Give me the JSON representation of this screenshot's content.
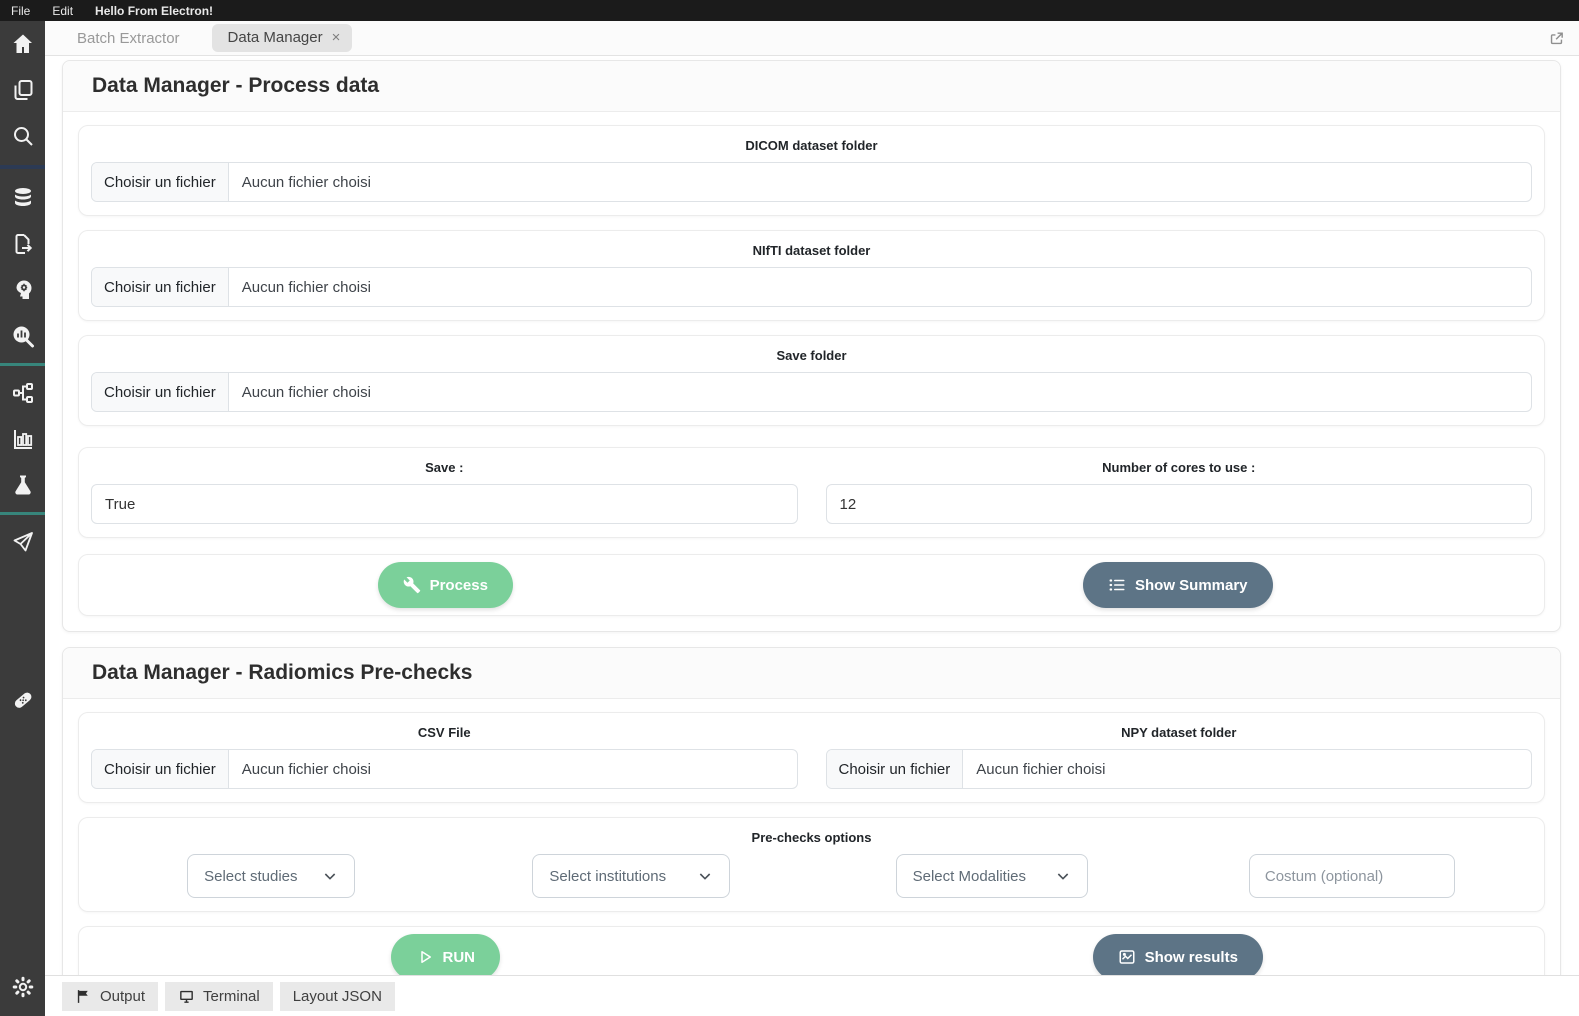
{
  "menu": {
    "file": "File",
    "edit": "Edit",
    "app_title": "Hello From Electron!"
  },
  "tabs": {
    "inactive_label": "Batch Extractor",
    "active_label": "Data Manager",
    "close_glyph": "×"
  },
  "strings": {
    "file_button": "Choisir un fichier",
    "file_empty": "Aucun fichier choisi"
  },
  "sidebar": {
    "icons": [
      "home-icon",
      "copy-icon",
      "search-icon",
      "database-icon",
      "file-export-icon",
      "ai-head-icon",
      "chart-search-icon",
      "nodes-icon",
      "bar-chart-icon",
      "flask-icon",
      "send-icon",
      "bandage-icon",
      "gear-icon"
    ]
  },
  "process_card": {
    "title": "Data Manager - Process data",
    "file_groups": [
      {
        "label": "DICOM dataset folder"
      },
      {
        "label": "NIfTI dataset folder"
      },
      {
        "label": "Save folder"
      }
    ],
    "save_label": "Save :",
    "save_value": "True",
    "cores_label": "Number of cores to use :",
    "cores_value": "12",
    "process_button": "Process",
    "summary_button": "Show Summary"
  },
  "prechecks_card": {
    "title": "Data Manager - Radiomics Pre-checks",
    "csv_label": "CSV File",
    "npy_label": "NPY dataset folder",
    "options_label": "Pre-checks options",
    "select_studies": "Select studies",
    "select_institutions": "Select institutions",
    "select_modalities": "Select Modalities",
    "custom_placeholder": "Costum (optional)",
    "run_button": "RUN",
    "results_button": "Show results"
  },
  "bottom_bar": {
    "output": "Output",
    "terminal": "Terminal",
    "layout_json": "Layout JSON"
  },
  "colors": {
    "accent_green": "#7bd09a",
    "accent_slate": "#5d7486",
    "sidebar_bg": "#3b3b3b",
    "menubar_bg": "#1b1b1b",
    "divider_navy": "#2c3a54",
    "divider_teal": "#37857b"
  }
}
